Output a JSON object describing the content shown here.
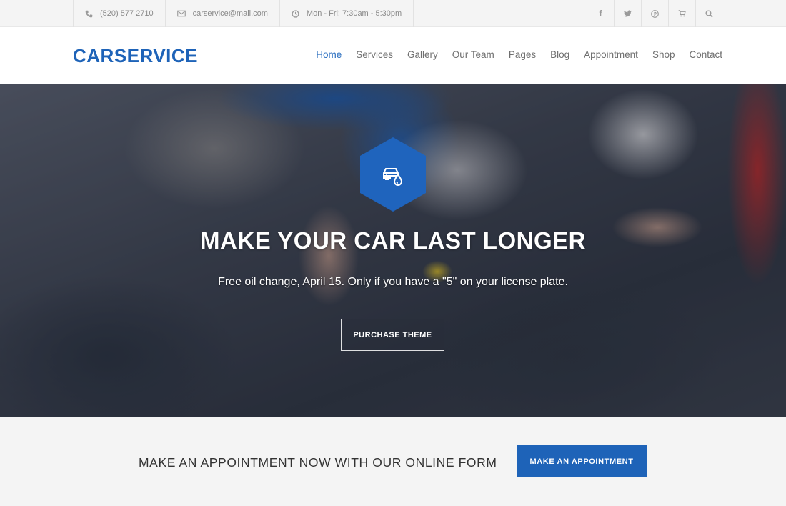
{
  "topbar": {
    "contact": [
      {
        "icon": "phone-icon",
        "text": "(520) 577 2710"
      },
      {
        "icon": "envelope-icon",
        "text": "carservice@mail.com"
      },
      {
        "icon": "clock-icon",
        "text": "Mon - Fri: 7:30am - 5:30pm"
      }
    ],
    "social": [
      {
        "icon": "facebook-icon",
        "glyph": "f"
      },
      {
        "icon": "twitter-icon",
        "glyph": "🐦"
      },
      {
        "icon": "pinterest-icon",
        "glyph": "℗"
      },
      {
        "icon": "cart-icon",
        "glyph": "🛒"
      },
      {
        "icon": "search-icon",
        "glyph": "⌕"
      }
    ]
  },
  "header": {
    "logo": "CARSERVICE",
    "nav": [
      "Home",
      "Services",
      "Gallery",
      "Our Team",
      "Pages",
      "Blog",
      "Appointment",
      "Shop",
      "Contact"
    ],
    "active_nav": "Home"
  },
  "hero": {
    "icon": "car-oil-drop-icon",
    "title": "MAKE YOUR CAR LAST LONGER",
    "subtitle": "Free oil change, April 15. Only if you have a \"5\" on your license plate.",
    "button_label": "PURCHASE THEME"
  },
  "cta": {
    "text": "MAKE AN APPOINTMENT NOW WITH OUR ONLINE FORM",
    "button_label": "MAKE AN APPOINTMENT"
  },
  "colors": {
    "brand_blue": "#1e63b8",
    "topbar_bg": "#f4f4f4",
    "nav_text": "#6f6f6f",
    "nav_active": "#2a6ebf"
  }
}
